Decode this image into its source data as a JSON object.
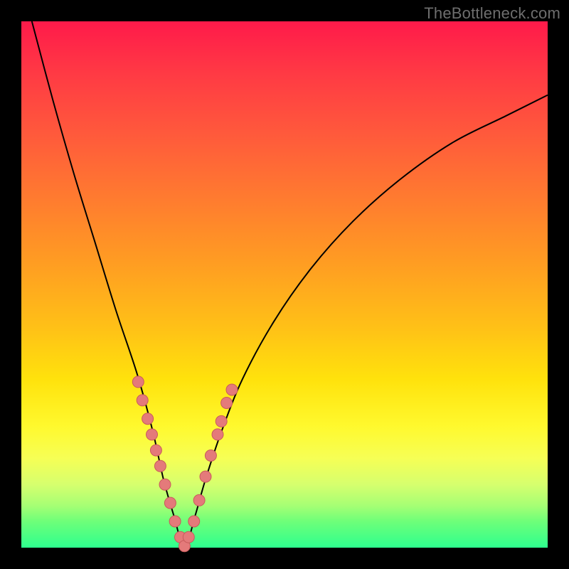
{
  "watermark": "TheBottleneck.com",
  "chart_data": {
    "type": "line",
    "title": "",
    "xlabel": "",
    "ylabel": "",
    "xlim": [
      0,
      100
    ],
    "ylim": [
      0,
      100
    ],
    "grid": false,
    "legend": false,
    "notes": "V-shaped bottleneck curve over red→green vertical gradient. Axes unlabeled; y≈100 is top (red), y≈0 bottom (green). Minimum near x≈31, y≈0.",
    "series": [
      {
        "name": "bottleneck-curve",
        "x": [
          2,
          6,
          10,
          14,
          18,
          22,
          25,
          27,
          29,
          31,
          33,
          35,
          38,
          42,
          48,
          55,
          63,
          72,
          82,
          92,
          100
        ],
        "y": [
          100,
          85,
          71,
          58,
          45,
          33,
          22,
          13,
          6,
          0,
          6,
          13,
          22,
          32,
          43,
          53,
          62,
          70,
          77,
          82,
          86
        ]
      }
    ],
    "markers": {
      "name": "highlight-points",
      "x": [
        22.2,
        23.0,
        24.0,
        24.8,
        25.6,
        26.4,
        27.3,
        28.3,
        29.2,
        30.2,
        31.0,
        31.8,
        32.8,
        33.8,
        35.0,
        36.0,
        37.3,
        38.0,
        39.0,
        40.0
      ],
      "y": [
        31.5,
        28.0,
        24.5,
        21.5,
        18.5,
        15.5,
        12.0,
        8.5,
        5.0,
        2.0,
        0.3,
        2.0,
        5.0,
        9.0,
        13.5,
        17.5,
        21.5,
        24.0,
        27.5,
        30.0
      ]
    }
  }
}
